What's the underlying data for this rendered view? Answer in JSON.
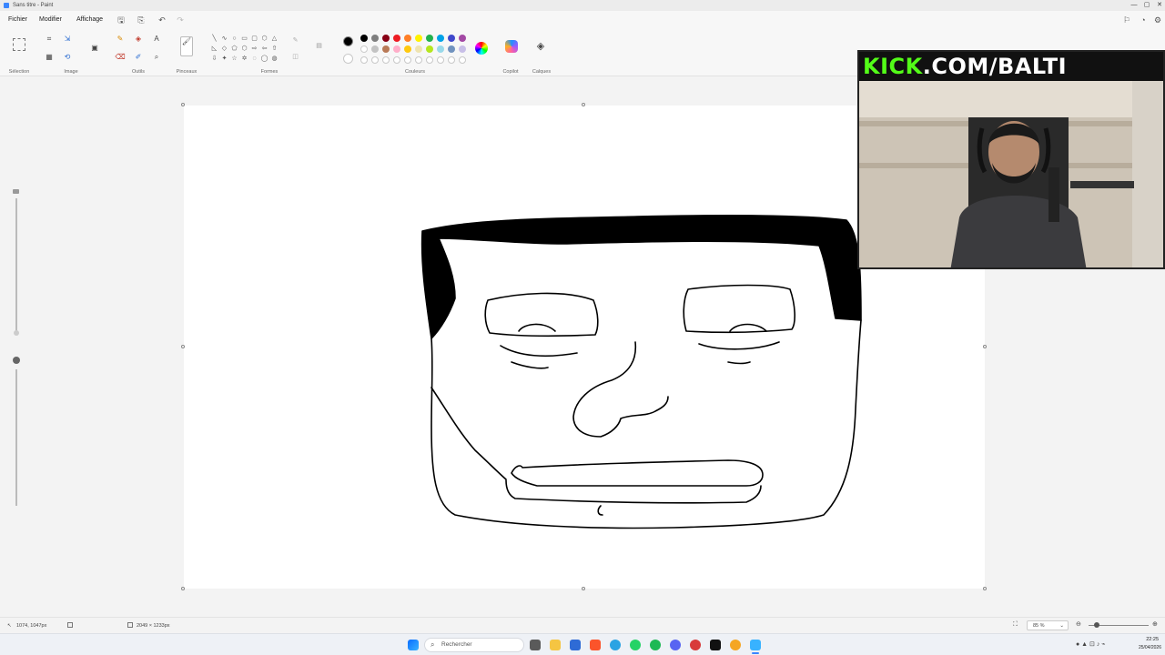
{
  "window": {
    "title": "Sans titre - Paint"
  },
  "menu": {
    "file": "Fichier",
    "edit": "Modifier",
    "view": "Affichage"
  },
  "ribbon": {
    "groups": {
      "selection": "Sélection",
      "image": "Image",
      "tools": "Outils",
      "brushes": "Pinceaux",
      "shapes": "Formes",
      "colors": "Couleurs",
      "copilot": "Copilot",
      "layers": "Calques"
    },
    "palette_row1": [
      "#000000",
      "#7f7f7f",
      "#880015",
      "#ed1c24",
      "#ff7f27",
      "#fff200",
      "#22b14c",
      "#00a2e8",
      "#3f48cc",
      "#a349a4"
    ],
    "palette_row2": [
      "#ffffff",
      "#c3c3c3",
      "#b97a57",
      "#ffaec9",
      "#ffc90e",
      "#efe4b0",
      "#b5e61d",
      "#99d9ea",
      "#7092be",
      "#c8bfe7"
    ],
    "primary_color": "#000000"
  },
  "status": {
    "cursor_pos": "1074, 1047px",
    "canvas_size": "2049 × 1233px",
    "zoom": "85 %"
  },
  "overlay": {
    "brand": "KICK",
    "url": ".COM/BALTI"
  },
  "taskbar": {
    "search_placeholder": "Rechercher",
    "time": "22:25",
    "date": "25/04/2026"
  }
}
